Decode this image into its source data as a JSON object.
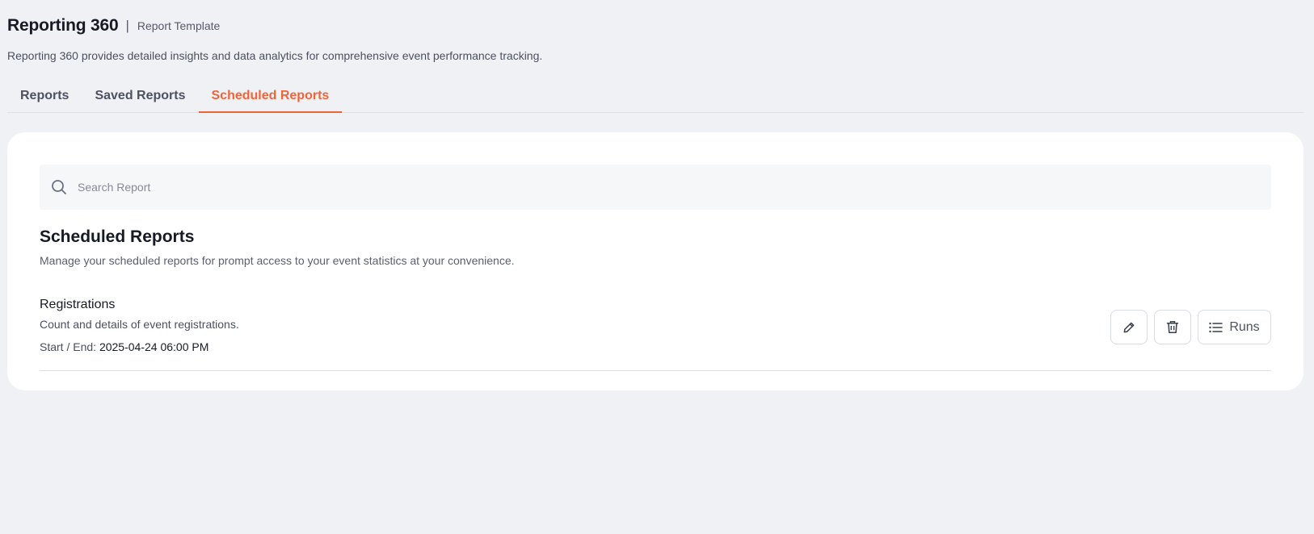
{
  "header": {
    "title": "Reporting 360",
    "separator": "|",
    "subtitle": "Report Template",
    "description": "Reporting 360 provides detailed insights and data analytics for comprehensive event performance tracking."
  },
  "tabs": [
    {
      "label": "Reports",
      "active": false
    },
    {
      "label": "Saved Reports",
      "active": false
    },
    {
      "label": "Scheduled Reports",
      "active": true
    }
  ],
  "search": {
    "placeholder": "Search Report",
    "value": "",
    "icon": "search-icon"
  },
  "section": {
    "title": "Scheduled Reports",
    "description": "Manage your scheduled reports for prompt access to your event statistics at your convenience."
  },
  "reports": [
    {
      "name": "Registrations",
      "description": "Count and details of event registrations.",
      "dates_label": "Start / End:",
      "dates_value": "2025-04-24 06:00 PM",
      "actions": {
        "edit_icon": "pencil-icon",
        "delete_icon": "trash-icon",
        "runs_icon": "list-icon",
        "runs_label": "Runs"
      }
    }
  ],
  "colors": {
    "accent": "#f0643a",
    "background": "#f0f1f5",
    "card": "#ffffff"
  }
}
